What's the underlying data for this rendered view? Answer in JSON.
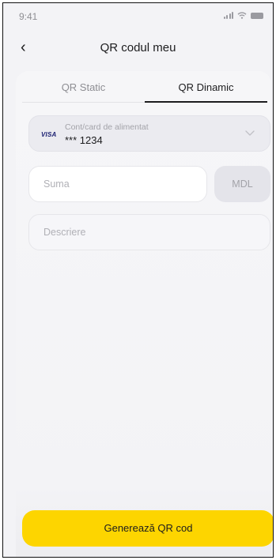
{
  "status_bar": {
    "time": "9:41",
    "icons": [
      "signal-icon",
      "wifi-icon",
      "battery-icon"
    ]
  },
  "nav": {
    "back_icon": "chevron-left-icon",
    "back_glyph": "‹",
    "title": "QR codul meu"
  },
  "tabs": [
    {
      "label": "QR Static",
      "active": false
    },
    {
      "label": "QR Dinamic",
      "active": true
    }
  ],
  "card_select": {
    "brand": "VISA",
    "label": "Cont/card de alimentat",
    "number": "*** 1234",
    "icon": "chevron-down-icon"
  },
  "amount": {
    "placeholder": "Suma",
    "value": "",
    "currency": "MDL"
  },
  "description": {
    "placeholder": "Descriere",
    "value": ""
  },
  "generate_button": {
    "label": "Generează QR cod"
  },
  "colors": {
    "accent": "#fdd500",
    "background": "#f3f3f6",
    "text": "#1c1c1e",
    "muted": "#8e8e93"
  }
}
